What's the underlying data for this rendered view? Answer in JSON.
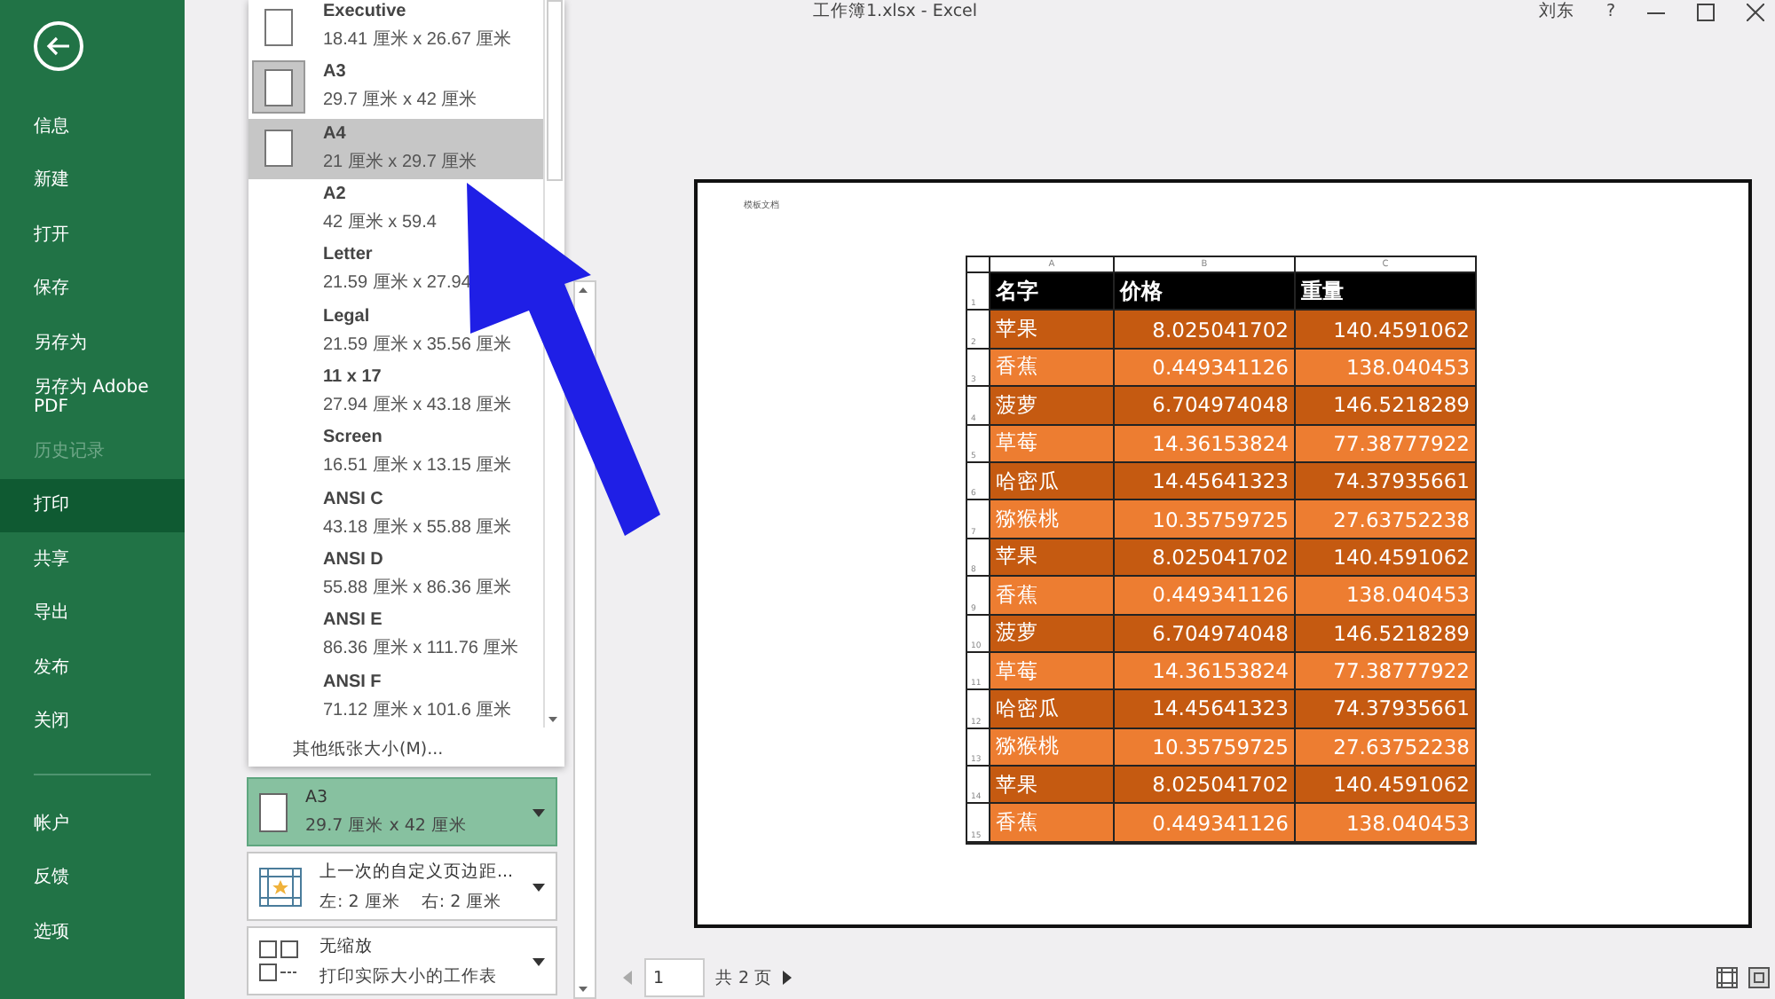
{
  "window": {
    "title": "工作簿1.xlsx  -  Excel",
    "user": "刘东",
    "help": "?"
  },
  "sidebar": {
    "items": [
      {
        "label": "信息",
        "selected": false,
        "disabled": false
      },
      {
        "label": "新建",
        "selected": false,
        "disabled": false
      },
      {
        "label": "打开",
        "selected": false,
        "disabled": false
      },
      {
        "label": "保存",
        "selected": false,
        "disabled": false
      },
      {
        "label": "另存为",
        "selected": false,
        "disabled": false
      },
      {
        "label": "另存为 Adobe PDF",
        "selected": false,
        "disabled": false
      },
      {
        "label": "历史记录",
        "selected": false,
        "disabled": true
      },
      {
        "label": "打印",
        "selected": true,
        "disabled": false
      },
      {
        "label": "共享",
        "selected": false,
        "disabled": false
      },
      {
        "label": "导出",
        "selected": false,
        "disabled": false
      },
      {
        "label": "发布",
        "selected": false,
        "disabled": false
      },
      {
        "label": "关闭",
        "selected": false,
        "disabled": false
      }
    ],
    "bottom_items": [
      {
        "label": "帐户",
        "selected": false
      },
      {
        "label": "反馈",
        "selected": false
      },
      {
        "label": "选项",
        "selected": false
      }
    ]
  },
  "paper_menu": {
    "items": [
      {
        "name": "Executive",
        "size": "18.41 厘米 x 26.67 厘米",
        "selected": false,
        "hovered": false,
        "has_icon": true
      },
      {
        "name": "A3",
        "size": "29.7 厘米 x 42 厘米",
        "selected": true,
        "hovered": false,
        "has_icon": true
      },
      {
        "name": "A4",
        "size": "21 厘米 x 29.7 厘米",
        "selected": false,
        "hovered": true,
        "has_icon": true
      },
      {
        "name": "A2",
        "size": "42 厘米 x 59.4",
        "selected": false,
        "hovered": false,
        "has_icon": false
      },
      {
        "name": "Letter",
        "size": "21.59 厘米 x 27.94",
        "selected": false,
        "hovered": false,
        "has_icon": false
      },
      {
        "name": "Legal",
        "size": "21.59 厘米 x 35.56 厘米",
        "selected": false,
        "hovered": false,
        "has_icon": false
      },
      {
        "name": "11 x 17",
        "size": "27.94 厘米 x 43.18 厘米",
        "selected": false,
        "hovered": false,
        "has_icon": false
      },
      {
        "name": "Screen",
        "size": "16.51 厘米 x 13.15 厘米",
        "selected": false,
        "hovered": false,
        "has_icon": false
      },
      {
        "name": "ANSI C",
        "size": "43.18 厘米 x 55.88 厘米",
        "selected": false,
        "hovered": false,
        "has_icon": false
      },
      {
        "name": "ANSI D",
        "size": "55.88 厘米 x 86.36 厘米",
        "selected": false,
        "hovered": false,
        "has_icon": false
      },
      {
        "name": "ANSI E",
        "size": "86.36 厘米 x 111.76 厘米",
        "selected": false,
        "hovered": false,
        "has_icon": false
      },
      {
        "name": "ANSI F",
        "size": "71.12 厘米 x 101.6 厘米",
        "selected": false,
        "hovered": false,
        "has_icon": false
      }
    ],
    "more": "其他纸张大小(M)..."
  },
  "settings": [
    {
      "kind": "paper",
      "title": "A3",
      "detail": "29.7 厘米 x 42 厘米",
      "selected": true
    },
    {
      "kind": "margins",
      "title": "上一次的自定义页边距...",
      "detail": "左: 2 厘米    右: 2 厘米",
      "selected": false
    },
    {
      "kind": "scaling",
      "title": "无缩放",
      "detail": "打印实际大小的工作表",
      "selected": false
    }
  ],
  "preview": {
    "header": "模板文档",
    "columns": [
      "A",
      "B",
      "C"
    ],
    "rows": [
      {
        "number": "1",
        "cells": [
          "名字",
          "价格",
          "重量"
        ],
        "kind": "header"
      },
      {
        "number": "2",
        "cells": [
          "苹果",
          "8.025041702",
          "140.4591062"
        ],
        "kind": "dark"
      },
      {
        "number": "3",
        "cells": [
          "香蕉",
          "0.449341126",
          "138.040453"
        ],
        "kind": "light"
      },
      {
        "number": "4",
        "cells": [
          "菠萝",
          "6.704974048",
          "146.5218289"
        ],
        "kind": "dark"
      },
      {
        "number": "5",
        "cells": [
          "草莓",
          "14.36153824",
          "77.38777922"
        ],
        "kind": "light"
      },
      {
        "number": "6",
        "cells": [
          "哈密瓜",
          "14.45641323",
          "74.37935661"
        ],
        "kind": "dark"
      },
      {
        "number": "7",
        "cells": [
          "猕猴桃",
          "10.35759725",
          "27.63752238"
        ],
        "kind": "light"
      },
      {
        "number": "8",
        "cells": [
          "苹果",
          "8.025041702",
          "140.4591062"
        ],
        "kind": "dark"
      },
      {
        "number": "9",
        "cells": [
          "香蕉",
          "0.449341126",
          "138.040453"
        ],
        "kind": "light"
      },
      {
        "number": "10",
        "cells": [
          "菠萝",
          "6.704974048",
          "146.5218289"
        ],
        "kind": "dark"
      },
      {
        "number": "11",
        "cells": [
          "草莓",
          "14.36153824",
          "77.38777922"
        ],
        "kind": "light"
      },
      {
        "number": "12",
        "cells": [
          "哈密瓜",
          "14.45641323",
          "74.37935661"
        ],
        "kind": "dark"
      },
      {
        "number": "13",
        "cells": [
          "猕猴桃",
          "10.35759725",
          "27.63752238"
        ],
        "kind": "light"
      },
      {
        "number": "14",
        "cells": [
          "苹果",
          "8.025041702",
          "140.4591062"
        ],
        "kind": "dark"
      },
      {
        "number": "15",
        "cells": [
          "香蕉",
          "0.449341126",
          "138.040453"
        ],
        "kind": "light"
      }
    ]
  },
  "pager": {
    "page": "1",
    "total": "共 2 页"
  }
}
